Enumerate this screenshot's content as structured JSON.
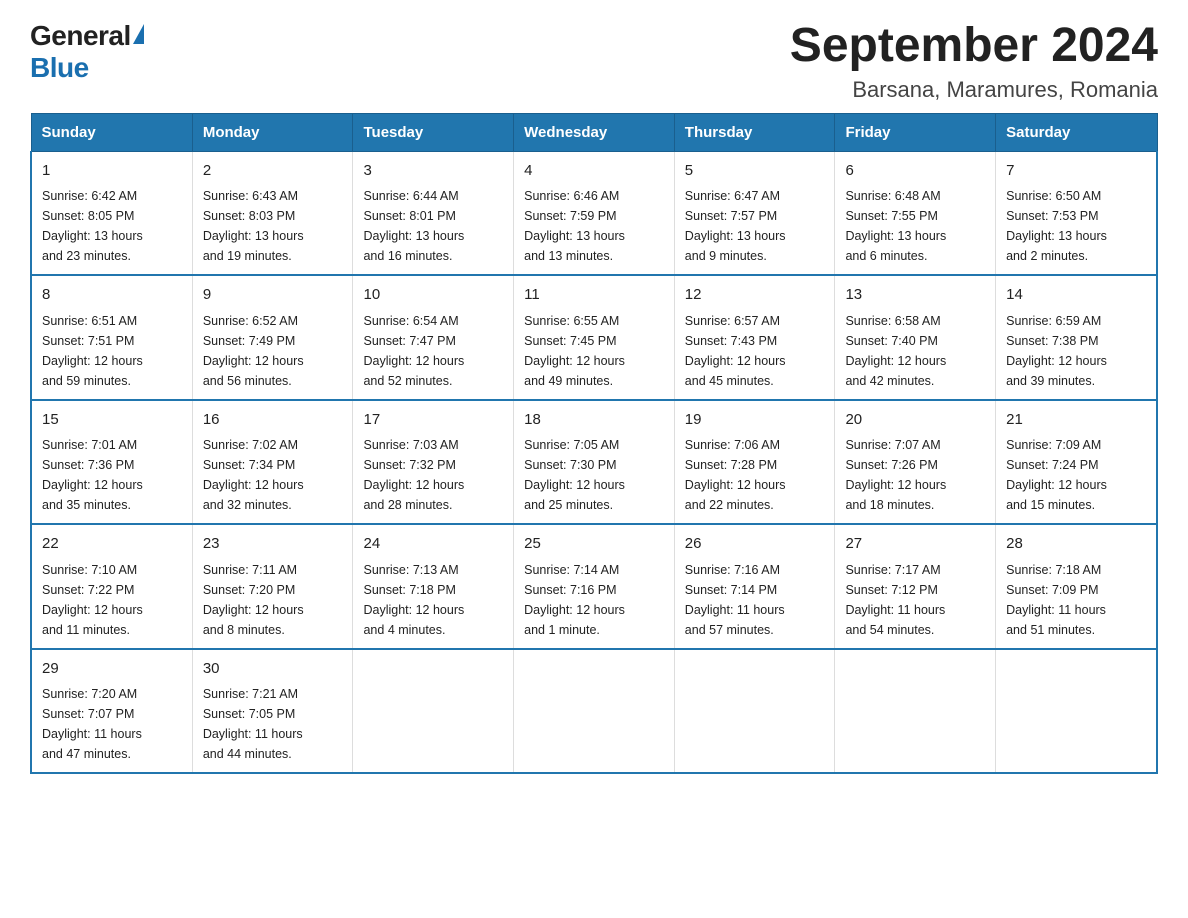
{
  "logo": {
    "general": "General",
    "blue": "Blue",
    "arrow": "▶"
  },
  "title": "September 2024",
  "subtitle": "Barsana, Maramures, Romania",
  "days_of_week": [
    "Sunday",
    "Monday",
    "Tuesday",
    "Wednesday",
    "Thursday",
    "Friday",
    "Saturday"
  ],
  "weeks": [
    [
      {
        "day": "1",
        "info": "Sunrise: 6:42 AM\nSunset: 8:05 PM\nDaylight: 13 hours\nand 23 minutes."
      },
      {
        "day": "2",
        "info": "Sunrise: 6:43 AM\nSunset: 8:03 PM\nDaylight: 13 hours\nand 19 minutes."
      },
      {
        "day": "3",
        "info": "Sunrise: 6:44 AM\nSunset: 8:01 PM\nDaylight: 13 hours\nand 16 minutes."
      },
      {
        "day": "4",
        "info": "Sunrise: 6:46 AM\nSunset: 7:59 PM\nDaylight: 13 hours\nand 13 minutes."
      },
      {
        "day": "5",
        "info": "Sunrise: 6:47 AM\nSunset: 7:57 PM\nDaylight: 13 hours\nand 9 minutes."
      },
      {
        "day": "6",
        "info": "Sunrise: 6:48 AM\nSunset: 7:55 PM\nDaylight: 13 hours\nand 6 minutes."
      },
      {
        "day": "7",
        "info": "Sunrise: 6:50 AM\nSunset: 7:53 PM\nDaylight: 13 hours\nand 2 minutes."
      }
    ],
    [
      {
        "day": "8",
        "info": "Sunrise: 6:51 AM\nSunset: 7:51 PM\nDaylight: 12 hours\nand 59 minutes."
      },
      {
        "day": "9",
        "info": "Sunrise: 6:52 AM\nSunset: 7:49 PM\nDaylight: 12 hours\nand 56 minutes."
      },
      {
        "day": "10",
        "info": "Sunrise: 6:54 AM\nSunset: 7:47 PM\nDaylight: 12 hours\nand 52 minutes."
      },
      {
        "day": "11",
        "info": "Sunrise: 6:55 AM\nSunset: 7:45 PM\nDaylight: 12 hours\nand 49 minutes."
      },
      {
        "day": "12",
        "info": "Sunrise: 6:57 AM\nSunset: 7:43 PM\nDaylight: 12 hours\nand 45 minutes."
      },
      {
        "day": "13",
        "info": "Sunrise: 6:58 AM\nSunset: 7:40 PM\nDaylight: 12 hours\nand 42 minutes."
      },
      {
        "day": "14",
        "info": "Sunrise: 6:59 AM\nSunset: 7:38 PM\nDaylight: 12 hours\nand 39 minutes."
      }
    ],
    [
      {
        "day": "15",
        "info": "Sunrise: 7:01 AM\nSunset: 7:36 PM\nDaylight: 12 hours\nand 35 minutes."
      },
      {
        "day": "16",
        "info": "Sunrise: 7:02 AM\nSunset: 7:34 PM\nDaylight: 12 hours\nand 32 minutes."
      },
      {
        "day": "17",
        "info": "Sunrise: 7:03 AM\nSunset: 7:32 PM\nDaylight: 12 hours\nand 28 minutes."
      },
      {
        "day": "18",
        "info": "Sunrise: 7:05 AM\nSunset: 7:30 PM\nDaylight: 12 hours\nand 25 minutes."
      },
      {
        "day": "19",
        "info": "Sunrise: 7:06 AM\nSunset: 7:28 PM\nDaylight: 12 hours\nand 22 minutes."
      },
      {
        "day": "20",
        "info": "Sunrise: 7:07 AM\nSunset: 7:26 PM\nDaylight: 12 hours\nand 18 minutes."
      },
      {
        "day": "21",
        "info": "Sunrise: 7:09 AM\nSunset: 7:24 PM\nDaylight: 12 hours\nand 15 minutes."
      }
    ],
    [
      {
        "day": "22",
        "info": "Sunrise: 7:10 AM\nSunset: 7:22 PM\nDaylight: 12 hours\nand 11 minutes."
      },
      {
        "day": "23",
        "info": "Sunrise: 7:11 AM\nSunset: 7:20 PM\nDaylight: 12 hours\nand 8 minutes."
      },
      {
        "day": "24",
        "info": "Sunrise: 7:13 AM\nSunset: 7:18 PM\nDaylight: 12 hours\nand 4 minutes."
      },
      {
        "day": "25",
        "info": "Sunrise: 7:14 AM\nSunset: 7:16 PM\nDaylight: 12 hours\nand 1 minute."
      },
      {
        "day": "26",
        "info": "Sunrise: 7:16 AM\nSunset: 7:14 PM\nDaylight: 11 hours\nand 57 minutes."
      },
      {
        "day": "27",
        "info": "Sunrise: 7:17 AM\nSunset: 7:12 PM\nDaylight: 11 hours\nand 54 minutes."
      },
      {
        "day": "28",
        "info": "Sunrise: 7:18 AM\nSunset: 7:09 PM\nDaylight: 11 hours\nand 51 minutes."
      }
    ],
    [
      {
        "day": "29",
        "info": "Sunrise: 7:20 AM\nSunset: 7:07 PM\nDaylight: 11 hours\nand 47 minutes."
      },
      {
        "day": "30",
        "info": "Sunrise: 7:21 AM\nSunset: 7:05 PM\nDaylight: 11 hours\nand 44 minutes."
      },
      {
        "day": "",
        "info": ""
      },
      {
        "day": "",
        "info": ""
      },
      {
        "day": "",
        "info": ""
      },
      {
        "day": "",
        "info": ""
      },
      {
        "day": "",
        "info": ""
      }
    ]
  ]
}
